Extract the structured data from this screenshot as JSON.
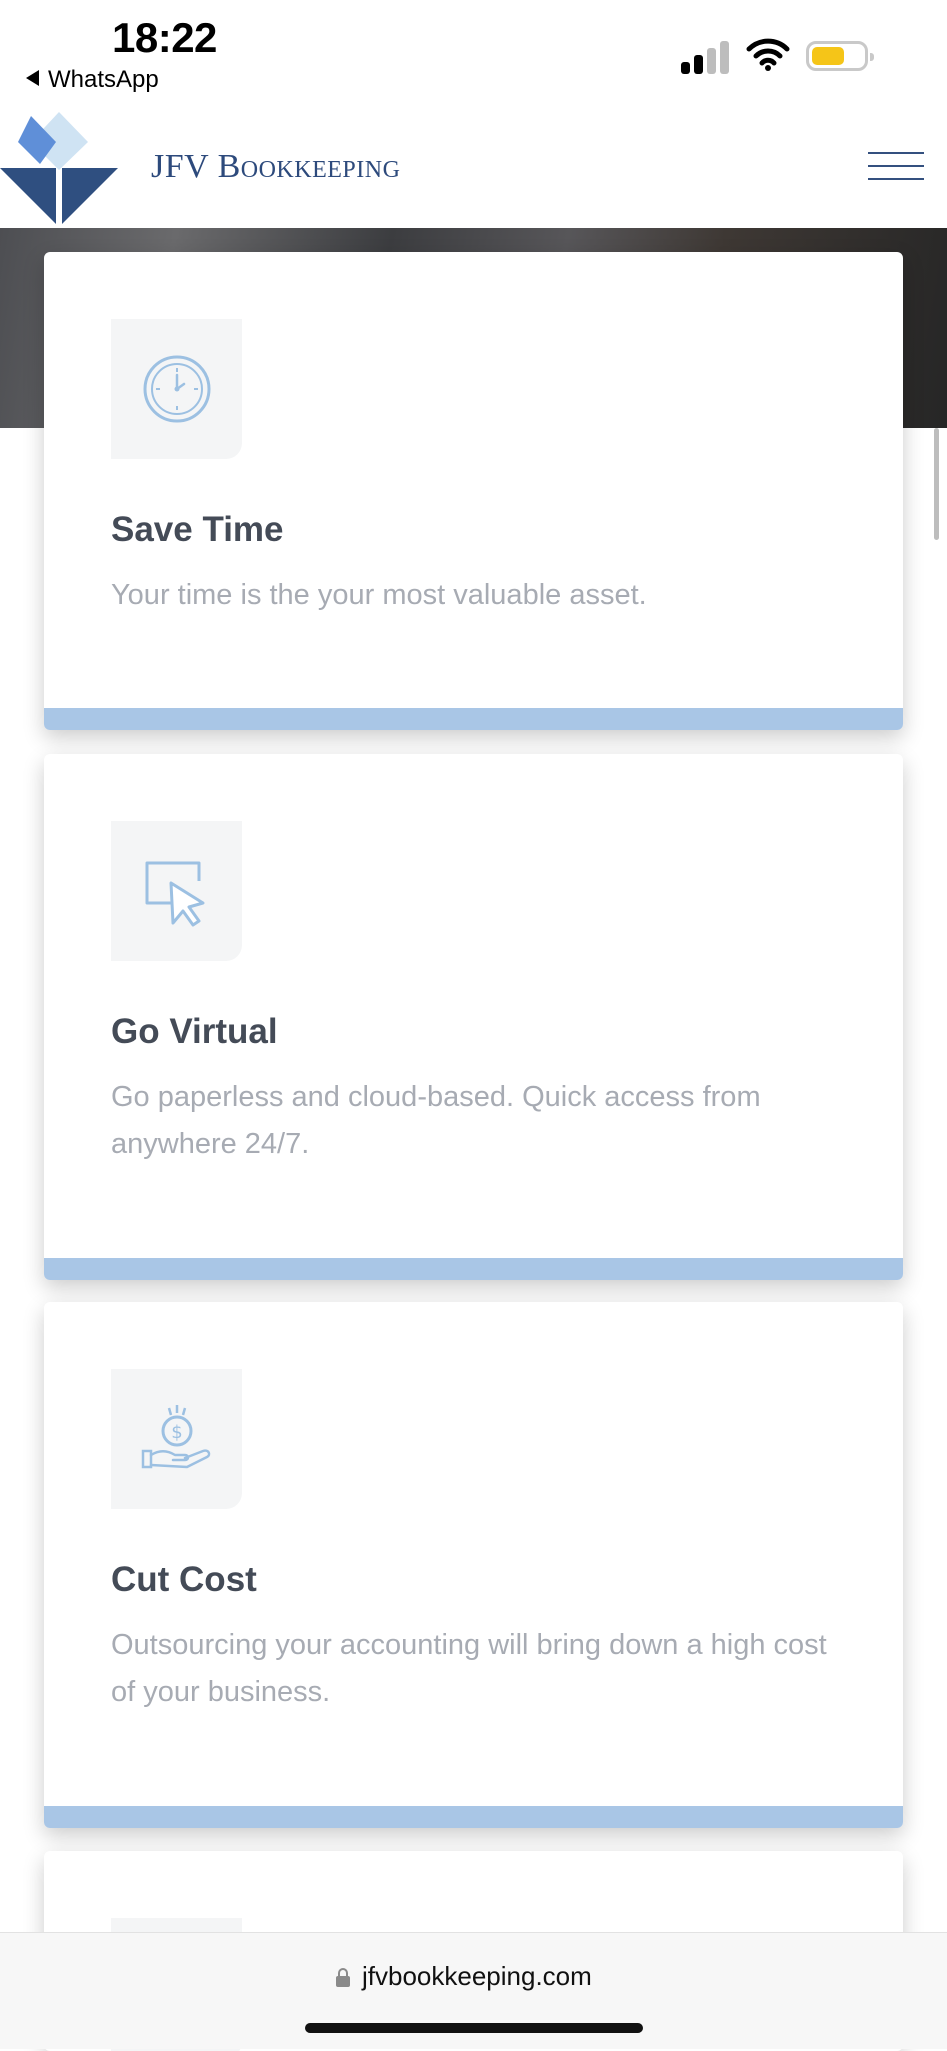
{
  "status_bar": {
    "time": "18:22",
    "back_app": "WhatsApp",
    "battery_color": "#f5c518"
  },
  "header": {
    "brand": "JFV Bookkeeping",
    "menu_icon": "hamburger-menu-icon"
  },
  "theme": {
    "brand_dark": "#2d4a7c",
    "card_accent": "#a9c6e6",
    "icon_stroke": "#9cc0e2"
  },
  "cards": [
    {
      "icon": "clock-icon",
      "title": "Save Time",
      "description": "Your time is the your most valuable asset."
    },
    {
      "icon": "cursor-click-icon",
      "title": "Go Virtual",
      "description": "Go paperless and cloud-based. Quick access from anywhere 24/7."
    },
    {
      "icon": "hand-coin-icon",
      "title": "Cut Cost",
      "description": "Outsourcing your accounting will bring down a high cost of your business."
    }
  ],
  "browser": {
    "url": "jfvbookkeeping.com"
  }
}
